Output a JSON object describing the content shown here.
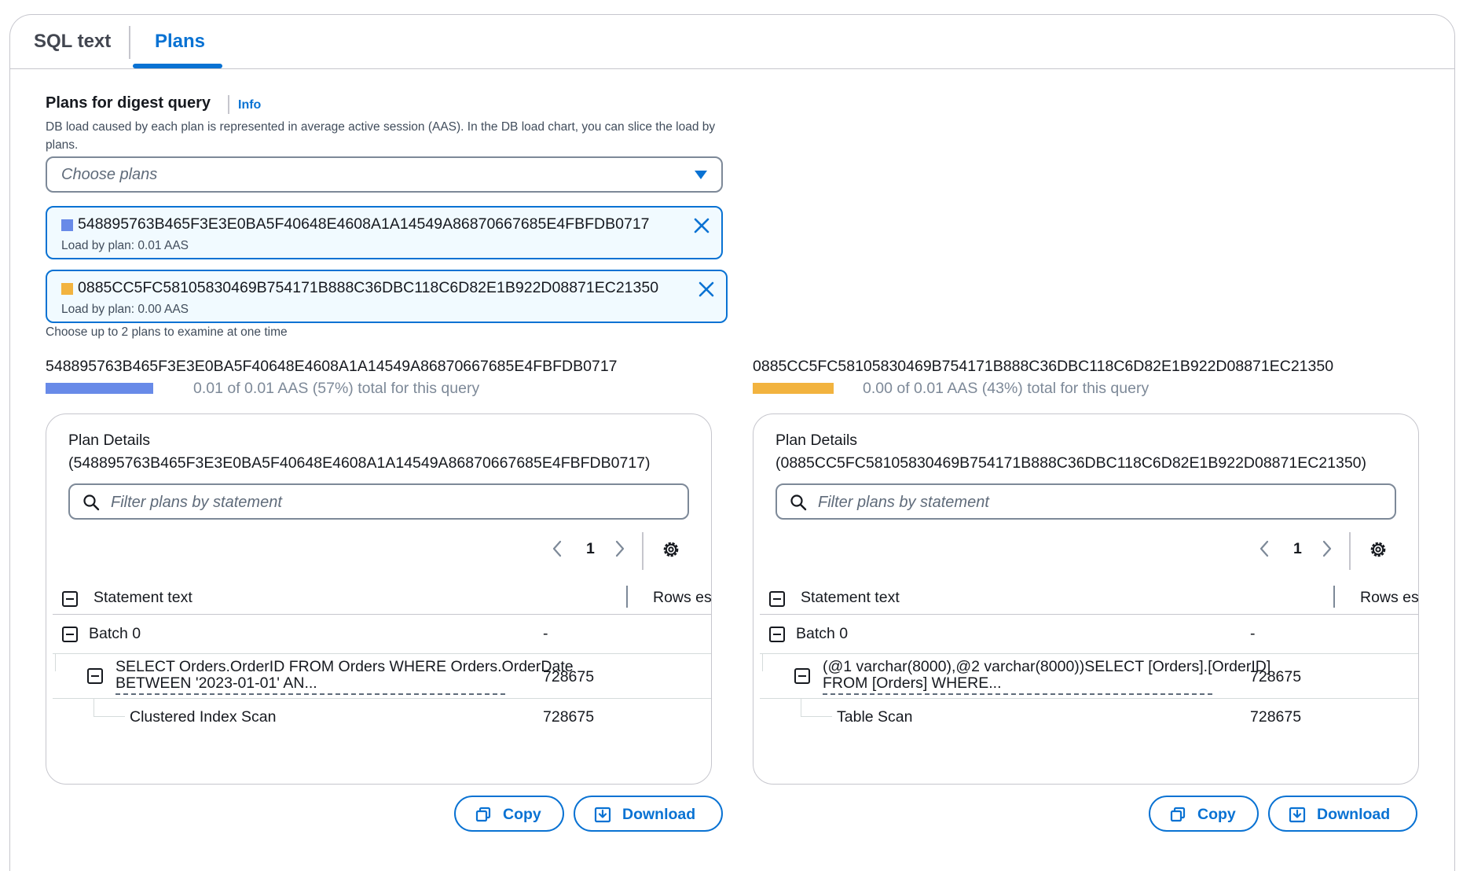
{
  "tabs": [
    {
      "label": "SQL text",
      "active": false
    },
    {
      "label": "Plans",
      "active": true
    }
  ],
  "header": {
    "title": "Plans for digest query",
    "info": "Info",
    "description": "DB load caused by each plan is represented in average active session (AAS). In the DB load chart, you can slice the load by plans."
  },
  "select": {
    "placeholder": "Choose plans",
    "icon": "caret-down-icon"
  },
  "tokens": [
    {
      "id": "548895763B465F3E3E0BA5F40648E4608A1A14549A86870667685E4FBFDB0717",
      "load": "Load by plan: 0.01 AAS",
      "color": "#688ae8"
    },
    {
      "id": "0885CC5FC58105830469B754171B888C36DBC118C6D82E1B922D08871EC21350",
      "load": "Load by plan: 0.00 AAS",
      "color": "#f2b33f"
    }
  ],
  "hint": "Choose up to 2 plans to examine at one time",
  "colors": {
    "accent": "#0972d3",
    "plan1": "#688ae8",
    "plan2": "#f2b33f"
  },
  "plans": [
    {
      "id": "548895763B465F3E3E0BA5F40648E4608A1A14549A86870667685E4FBFDB0717",
      "share": 0.57,
      "bar_label": "0.01 of 0.01 AAS (57%) total for this query",
      "details_title": "Plan Details",
      "details_id": "(548895763B465F3E3E0BA5F40648E4608A1A14549A86870667685E4FBFDB0717)",
      "filter_placeholder": "Filter plans by statement",
      "page": "1",
      "columns": [
        "Statement text",
        "Rows es..."
      ],
      "rows": [
        {
          "text": "Batch 0",
          "value": "-"
        },
        {
          "text_line1": "SELECT Orders.OrderID FROM Orders WHERE Orders.OrderDate",
          "text_line2": "BETWEEN '2023-01-01' AN...",
          "value": "728675"
        },
        {
          "text": "Clustered Index Scan",
          "value": "728675"
        }
      ],
      "copy": "Copy",
      "download": "Download"
    },
    {
      "id": "0885CC5FC58105830469B754171B888C36DBC118C6D82E1B922D08871EC21350",
      "share": 0.43,
      "bar_label": "0.00 of 0.01 AAS (43%) total for this query",
      "details_title": "Plan Details",
      "details_id": "(0885CC5FC58105830469B754171B888C36DBC118C6D82E1B922D08871EC21350)",
      "filter_placeholder": "Filter plans by statement",
      "page": "1",
      "columns": [
        "Statement text",
        "Rows es..."
      ],
      "rows": [
        {
          "text": "Batch 0",
          "value": "-"
        },
        {
          "text_line1": "(@1 varchar(8000),@2 varchar(8000))SELECT [Orders].[OrderID]",
          "text_line2": "FROM [Orders] WHERE...",
          "value": "728675"
        },
        {
          "text": "Table Scan",
          "value": "728675"
        }
      ],
      "copy": "Copy",
      "download": "Download"
    }
  ]
}
